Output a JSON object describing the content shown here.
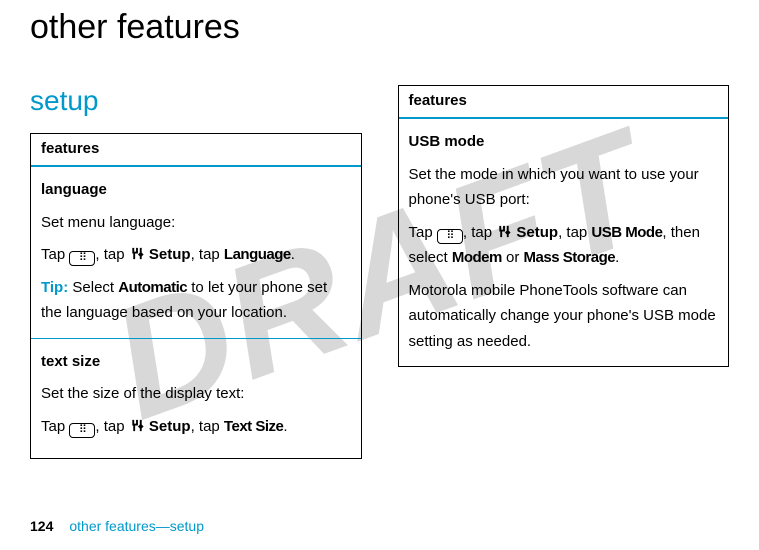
{
  "watermark": "DRAFT",
  "page_title": "other features",
  "section_heading": "setup",
  "left": {
    "header": "features",
    "row1": {
      "title": "language",
      "desc": "Set menu language:",
      "path_prefix": "Tap ",
      "path_mid1": ", tap ",
      "path_setup": " Setup",
      "path_mid2": ", tap ",
      "path_end": "Language",
      "path_period": ".",
      "tip_label": "Tip:",
      "tip_text_1": " Select ",
      "tip_bold": "Automatic",
      "tip_text_2": " to let your phone set the language based on your location."
    },
    "row2": {
      "title": "text size",
      "desc": "Set the size of the display text:",
      "path_prefix": "Tap ",
      "path_mid1": ", tap ",
      "path_setup": " Setup",
      "path_mid2": ", tap ",
      "path_end": "Text Size",
      "path_period": "."
    }
  },
  "right": {
    "header": "features",
    "row1": {
      "title": "USB mode",
      "desc": "Set the mode in which you want to use your phone's USB port:",
      "path_prefix": "Tap ",
      "path_mid1": ", tap ",
      "path_setup": " Setup",
      "path_mid2": ", tap ",
      "path_usb": "USB Mode",
      "path_mid3": ", then select ",
      "path_modem": "Modem",
      "path_or": " or ",
      "path_mass": "Mass Storage",
      "path_period": ".",
      "note": "Motorola mobile PhoneTools software can automatically change your phone's USB mode setting as needed."
    }
  },
  "footer": {
    "page_number": "124",
    "text": "other features—setup"
  }
}
